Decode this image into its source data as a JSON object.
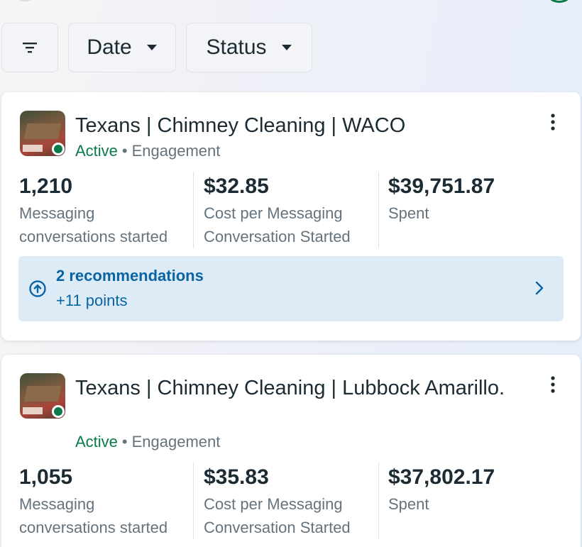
{
  "filters": {
    "filter_icon": "filter-lines-icon",
    "date_label": "Date",
    "status_label": "Status"
  },
  "campaigns": [
    {
      "title": "Texans | Chimney Cleaning | WACO",
      "status": "Active",
      "separator": "•",
      "objective": "Engagement",
      "metrics": [
        {
          "value": "1,210",
          "label_line1": "Messaging",
          "label_line2": "conversations started"
        },
        {
          "value": "$32.85",
          "label_line1": "Cost per Messaging",
          "label_line2": "Conversation Started"
        },
        {
          "value": "$39,751.87",
          "label_line1": "Spent",
          "label_line2": ""
        }
      ],
      "recommendations": {
        "title": "2 recommendations",
        "points": "+11 points"
      }
    },
    {
      "title": "Texans | Chimney Cleaning | Lubbock Amarillo.",
      "status": "Active",
      "separator": "•",
      "objective": "Engagement",
      "metrics": [
        {
          "value": "1,055",
          "label_line1": "Messaging",
          "label_line2": "conversations started"
        },
        {
          "value": "$35.83",
          "label_line1": "Cost per Messaging",
          "label_line2": "Conversation Started"
        },
        {
          "value": "$37,802.17",
          "label_line1": "Spent",
          "label_line2": ""
        }
      ]
    }
  ],
  "colors": {
    "active_green": "#0b7a4b",
    "link_blue": "#0a64a4",
    "reco_bg": "#dcebf5",
    "muted_text": "#65737e"
  },
  "icons": {
    "more": "more-vertical-icon",
    "recommendation": "arrow-up-circle-icon",
    "chevron": "chevron-right-icon",
    "dropdown": "caret-down-icon"
  }
}
